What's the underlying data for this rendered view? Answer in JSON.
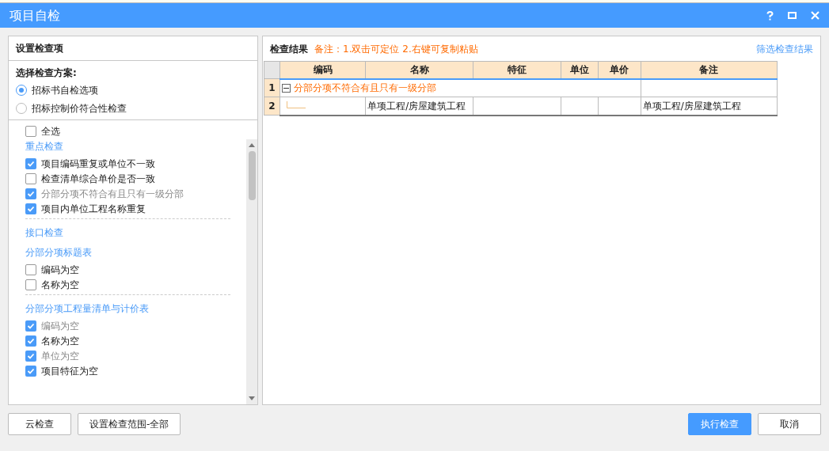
{
  "window": {
    "title": "项目自检"
  },
  "left_panel": {
    "heading": "设置检查项",
    "scheme_label": "选择检查方案:",
    "schemes": [
      {
        "label": "招标书自检选项",
        "selected": true
      },
      {
        "label": "招标控制价符合性检查",
        "selected": false
      }
    ],
    "select_all": {
      "label": "全选",
      "checked": false
    },
    "groups": [
      {
        "title": "重点检查",
        "separated": true,
        "items": [
          {
            "label": "项目编码重复或单位不一致",
            "checked": true,
            "disabled": false
          },
          {
            "label": "检查清单综合单价是否一致",
            "checked": false,
            "disabled": false
          },
          {
            "label": "分部分项不符合有且只有一级分部",
            "checked": true,
            "disabled": true
          },
          {
            "label": "项目内单位工程名称重复",
            "checked": true,
            "disabled": false
          }
        ]
      },
      {
        "title": "接口检查",
        "separated": false
      },
      {
        "title": "分部分项标题表",
        "separated": true,
        "items": [
          {
            "label": "编码为空",
            "checked": false,
            "disabled": false
          },
          {
            "label": "名称为空",
            "checked": false,
            "disabled": false
          }
        ]
      },
      {
        "title": "分部分项工程量清单与计价表",
        "separated": false,
        "items": [
          {
            "label": "编码为空",
            "checked": true,
            "disabled": true
          },
          {
            "label": "名称为空",
            "checked": true,
            "disabled": false
          },
          {
            "label": "单位为空",
            "checked": true,
            "disabled": true
          },
          {
            "label": "项目特征为空",
            "checked": true,
            "disabled": false
          }
        ]
      }
    ]
  },
  "right_panel": {
    "title": "检查结果",
    "note": "备注：1.双击可定位 2.右键可复制粘贴",
    "filter_link": "筛选检查结果",
    "table": {
      "columns": [
        "编码",
        "名称",
        "特征",
        "单位",
        "单价",
        "备注"
      ],
      "rows": [
        {
          "number": "1",
          "kind": "group",
          "expanded": true,
          "text": "分部分项不符合有且只有一级分部",
          "remark": ""
        },
        {
          "number": "2",
          "kind": "item",
          "cells": [
            "",
            "单项工程/房屋建筑工程",
            "",
            "",
            "",
            "单项工程/房屋建筑工程"
          ]
        }
      ]
    }
  },
  "footer": {
    "left_buttons": [
      "云检查",
      "设置检查范围-全部"
    ],
    "right_buttons": [
      {
        "label": "执行检查",
        "kind": "primary"
      },
      {
        "label": "取消",
        "kind": "default"
      }
    ]
  }
}
